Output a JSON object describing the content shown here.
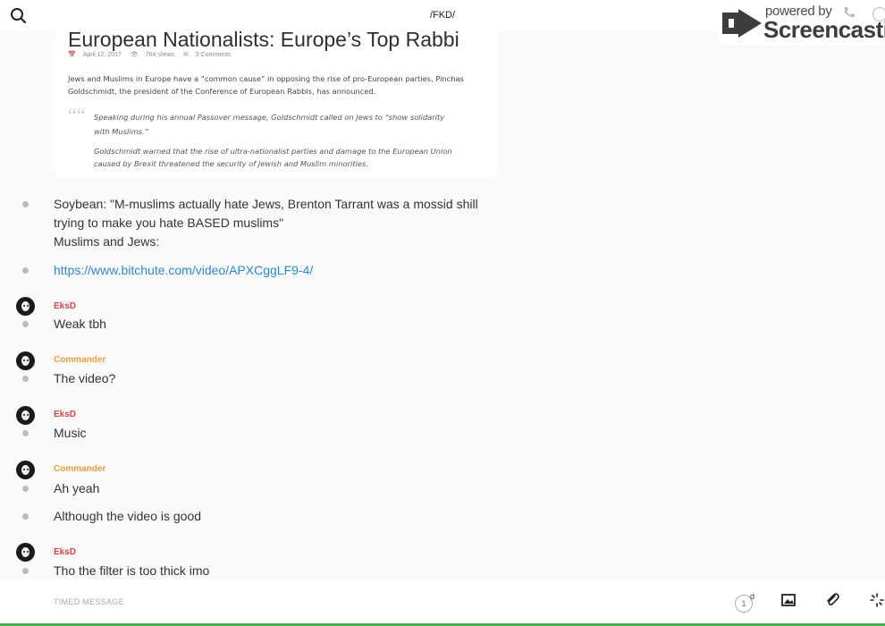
{
  "header": {
    "channel_title": "/FKD/",
    "search_icon": "search-icon"
  },
  "watermark": {
    "powered": "powered by",
    "brand": "Screencastify"
  },
  "article": {
    "title": "European Nationalists: Europe’s Top Rabbi",
    "date": "April 12, 2017",
    "views": "704 Views",
    "comments": "3 Comments",
    "intro": "Jews and Muslims in Europe have a “common cause” in opposing the rise of pro-European parties, Pinchas Goldschmidt, the president of the Conference of European Rabbis, has announced.",
    "quote1": "Speaking during his annual Passover message, Goldschmidt called on Jews to “show solidarity with Muslims.”",
    "quote2": "Goldschmidt warned that the rise of ultra-nationalist parties and damage to the European Union caused by Brexit threatened the security of Jewish and Muslim minorities."
  },
  "messages": {
    "soybean_line1": "Soybean: \"M-muslims actually hate Jews, Brenton Tarrant was a mossid shill",
    "soybean_line2": "trying to make you hate BASED muslims\"",
    "soybean_line3": "Muslims and Jews:",
    "link": "https://www.bitchute.com/video/APXCggLF9-4/",
    "m1_user": "EksD",
    "m1_text": "Weak tbh",
    "m2_user": "Commander",
    "m2_text": "The video?",
    "m3_user": "EksD",
    "m3_text": "Music",
    "m4_user": "Commander",
    "m4_text": "Ah yeah",
    "m5_text": "Although the video is good",
    "m6_user": "EksD",
    "m6_text": "Tho the filter is too thick imo"
  },
  "users": {
    "eksd_color": "#d9453f",
    "commander_color": "#e8a03c"
  },
  "composer": {
    "placeholder": "TIMED MESSAGE",
    "timer_value": "1",
    "timer_unit": "d",
    "icons": [
      "image-icon",
      "attachment-icon",
      "loading-icon"
    ]
  }
}
